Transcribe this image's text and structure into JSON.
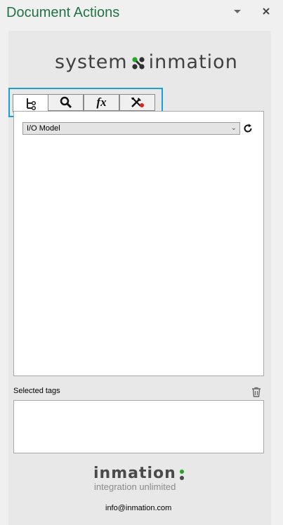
{
  "pane": {
    "title": "Document Actions"
  },
  "logo": {
    "left_word": "system",
    "right_word": "inmation"
  },
  "tabs": [
    {
      "name": "tree",
      "icon": "tree-hierarchy-icon",
      "active": true
    },
    {
      "name": "search",
      "icon": "search-icon",
      "active": false
    },
    {
      "name": "function",
      "icon": "function-icon",
      "label": "fx",
      "active": false
    },
    {
      "name": "tools",
      "icon": "tools-icon",
      "active": false
    }
  ],
  "model_select": {
    "value": "I/O Model"
  },
  "selected_tags": {
    "label": "Selected tags"
  },
  "footer": {
    "brand": "inmation",
    "tagline": "integration unlimited",
    "email": "info@inmation.com"
  },
  "colors": {
    "title_green": "#217346",
    "highlight_blue": "#1aa0d8",
    "logo_green": "#22a722",
    "logo_dark": "#303030",
    "status_red": "#e02020"
  }
}
